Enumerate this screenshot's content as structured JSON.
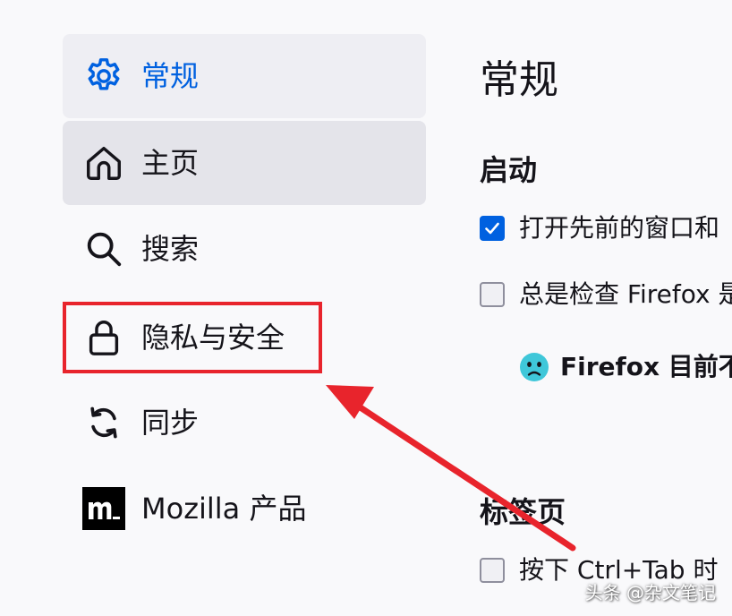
{
  "sidebar": {
    "items": [
      {
        "id": "general",
        "label": "常规",
        "icon": "gear-icon",
        "state": "selected"
      },
      {
        "id": "home",
        "label": "主页",
        "icon": "home-icon",
        "state": "hovered"
      },
      {
        "id": "search",
        "label": "搜索",
        "icon": "search-icon",
        "state": "normal"
      },
      {
        "id": "privacy",
        "label": "隐私与安全",
        "icon": "lock-icon",
        "state": "normal"
      },
      {
        "id": "sync",
        "label": "同步",
        "icon": "sync-icon",
        "state": "normal"
      },
      {
        "id": "mozilla",
        "label": "Mozilla 产品",
        "icon": "mozilla-logo-icon",
        "state": "normal"
      }
    ]
  },
  "main": {
    "title": "常规",
    "startup": {
      "heading": "启动",
      "restore_session": {
        "label": "打开先前的窗口和",
        "checked": true
      },
      "default_browser": {
        "label": "总是检查 Firefox 是",
        "checked": false
      },
      "status": {
        "label": "Firefox 目前不",
        "icon": "sad-face-icon"
      }
    },
    "tabs": {
      "heading": "标签页",
      "ctrl_tab": {
        "label": "按下 Ctrl+Tab 时",
        "checked": false
      }
    }
  },
  "overlay": {
    "watermark": "头条 @杂文笔记"
  },
  "colors": {
    "accent": "#0061e0",
    "annotation_red": "#e8242c",
    "selected_bg": "#eeeef3",
    "hover_bg": "#e4e4ea",
    "status_face": "#3fc7d9"
  }
}
